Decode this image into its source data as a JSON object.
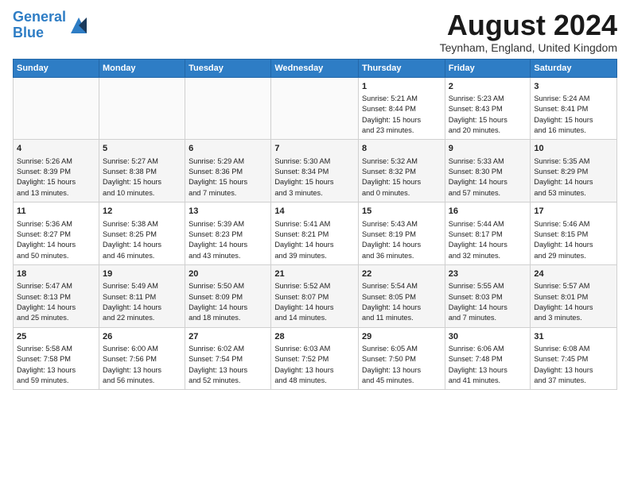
{
  "header": {
    "logo_line1": "General",
    "logo_line2": "Blue",
    "month_title": "August 2024",
    "location": "Teynham, England, United Kingdom"
  },
  "days_of_week": [
    "Sunday",
    "Monday",
    "Tuesday",
    "Wednesday",
    "Thursday",
    "Friday",
    "Saturday"
  ],
  "weeks": [
    [
      {
        "day": "",
        "content": ""
      },
      {
        "day": "",
        "content": ""
      },
      {
        "day": "",
        "content": ""
      },
      {
        "day": "",
        "content": ""
      },
      {
        "day": "1",
        "content": "Sunrise: 5:21 AM\nSunset: 8:44 PM\nDaylight: 15 hours\nand 23 minutes."
      },
      {
        "day": "2",
        "content": "Sunrise: 5:23 AM\nSunset: 8:43 PM\nDaylight: 15 hours\nand 20 minutes."
      },
      {
        "day": "3",
        "content": "Sunrise: 5:24 AM\nSunset: 8:41 PM\nDaylight: 15 hours\nand 16 minutes."
      }
    ],
    [
      {
        "day": "4",
        "content": "Sunrise: 5:26 AM\nSunset: 8:39 PM\nDaylight: 15 hours\nand 13 minutes."
      },
      {
        "day": "5",
        "content": "Sunrise: 5:27 AM\nSunset: 8:38 PM\nDaylight: 15 hours\nand 10 minutes."
      },
      {
        "day": "6",
        "content": "Sunrise: 5:29 AM\nSunset: 8:36 PM\nDaylight: 15 hours\nand 7 minutes."
      },
      {
        "day": "7",
        "content": "Sunrise: 5:30 AM\nSunset: 8:34 PM\nDaylight: 15 hours\nand 3 minutes."
      },
      {
        "day": "8",
        "content": "Sunrise: 5:32 AM\nSunset: 8:32 PM\nDaylight: 15 hours\nand 0 minutes."
      },
      {
        "day": "9",
        "content": "Sunrise: 5:33 AM\nSunset: 8:30 PM\nDaylight: 14 hours\nand 57 minutes."
      },
      {
        "day": "10",
        "content": "Sunrise: 5:35 AM\nSunset: 8:29 PM\nDaylight: 14 hours\nand 53 minutes."
      }
    ],
    [
      {
        "day": "11",
        "content": "Sunrise: 5:36 AM\nSunset: 8:27 PM\nDaylight: 14 hours\nand 50 minutes."
      },
      {
        "day": "12",
        "content": "Sunrise: 5:38 AM\nSunset: 8:25 PM\nDaylight: 14 hours\nand 46 minutes."
      },
      {
        "day": "13",
        "content": "Sunrise: 5:39 AM\nSunset: 8:23 PM\nDaylight: 14 hours\nand 43 minutes."
      },
      {
        "day": "14",
        "content": "Sunrise: 5:41 AM\nSunset: 8:21 PM\nDaylight: 14 hours\nand 39 minutes."
      },
      {
        "day": "15",
        "content": "Sunrise: 5:43 AM\nSunset: 8:19 PM\nDaylight: 14 hours\nand 36 minutes."
      },
      {
        "day": "16",
        "content": "Sunrise: 5:44 AM\nSunset: 8:17 PM\nDaylight: 14 hours\nand 32 minutes."
      },
      {
        "day": "17",
        "content": "Sunrise: 5:46 AM\nSunset: 8:15 PM\nDaylight: 14 hours\nand 29 minutes."
      }
    ],
    [
      {
        "day": "18",
        "content": "Sunrise: 5:47 AM\nSunset: 8:13 PM\nDaylight: 14 hours\nand 25 minutes."
      },
      {
        "day": "19",
        "content": "Sunrise: 5:49 AM\nSunset: 8:11 PM\nDaylight: 14 hours\nand 22 minutes."
      },
      {
        "day": "20",
        "content": "Sunrise: 5:50 AM\nSunset: 8:09 PM\nDaylight: 14 hours\nand 18 minutes."
      },
      {
        "day": "21",
        "content": "Sunrise: 5:52 AM\nSunset: 8:07 PM\nDaylight: 14 hours\nand 14 minutes."
      },
      {
        "day": "22",
        "content": "Sunrise: 5:54 AM\nSunset: 8:05 PM\nDaylight: 14 hours\nand 11 minutes."
      },
      {
        "day": "23",
        "content": "Sunrise: 5:55 AM\nSunset: 8:03 PM\nDaylight: 14 hours\nand 7 minutes."
      },
      {
        "day": "24",
        "content": "Sunrise: 5:57 AM\nSunset: 8:01 PM\nDaylight: 14 hours\nand 3 minutes."
      }
    ],
    [
      {
        "day": "25",
        "content": "Sunrise: 5:58 AM\nSunset: 7:58 PM\nDaylight: 13 hours\nand 59 minutes."
      },
      {
        "day": "26",
        "content": "Sunrise: 6:00 AM\nSunset: 7:56 PM\nDaylight: 13 hours\nand 56 minutes."
      },
      {
        "day": "27",
        "content": "Sunrise: 6:02 AM\nSunset: 7:54 PM\nDaylight: 13 hours\nand 52 minutes."
      },
      {
        "day": "28",
        "content": "Sunrise: 6:03 AM\nSunset: 7:52 PM\nDaylight: 13 hours\nand 48 minutes."
      },
      {
        "day": "29",
        "content": "Sunrise: 6:05 AM\nSunset: 7:50 PM\nDaylight: 13 hours\nand 45 minutes."
      },
      {
        "day": "30",
        "content": "Sunrise: 6:06 AM\nSunset: 7:48 PM\nDaylight: 13 hours\nand 41 minutes."
      },
      {
        "day": "31",
        "content": "Sunrise: 6:08 AM\nSunset: 7:45 PM\nDaylight: 13 hours\nand 37 minutes."
      }
    ]
  ]
}
